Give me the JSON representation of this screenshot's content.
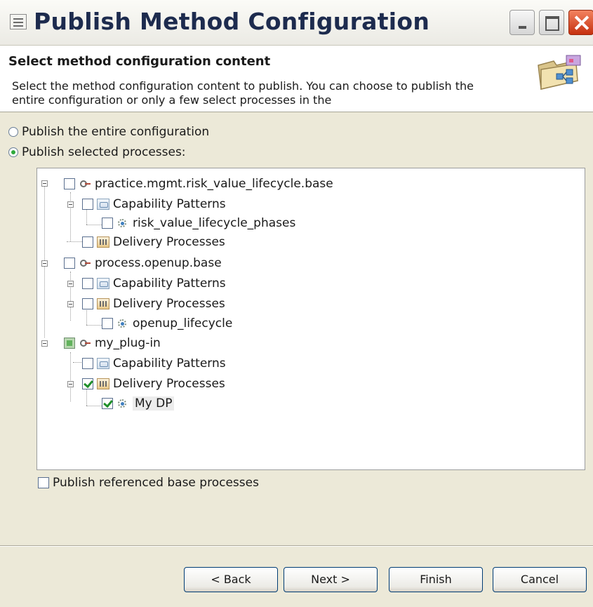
{
  "window": {
    "title": "Publish Method Configuration"
  },
  "header": {
    "title": "Select method configuration content",
    "description": "Select the method configuration content to publish. You can choose to publish the entire configuration or only a few select processes in the"
  },
  "options": {
    "publish_entire": "Publish the entire configuration",
    "publish_selected": "Publish selected processes:"
  },
  "tree": {
    "n1": "practice.mgmt.risk_value_lifecycle.base",
    "n1_cap": "Capability Patterns",
    "n1_cap_child": "risk_value_lifecycle_phases",
    "n1_dp": "Delivery Processes",
    "n2": "process.openup.base",
    "n2_cap": "Capability Patterns",
    "n2_dp": "Delivery Processes",
    "n2_dp_child": "openup_lifecycle",
    "n3": "my_plug-in",
    "n3_cap": "Capability Patterns",
    "n3_dp": "Delivery Processes",
    "n3_dp_child": "My DP"
  },
  "publish_referenced": "Publish referenced base processes",
  "buttons": {
    "back": "< Back",
    "next": "Next >",
    "finish": "Finish",
    "cancel": "Cancel"
  }
}
